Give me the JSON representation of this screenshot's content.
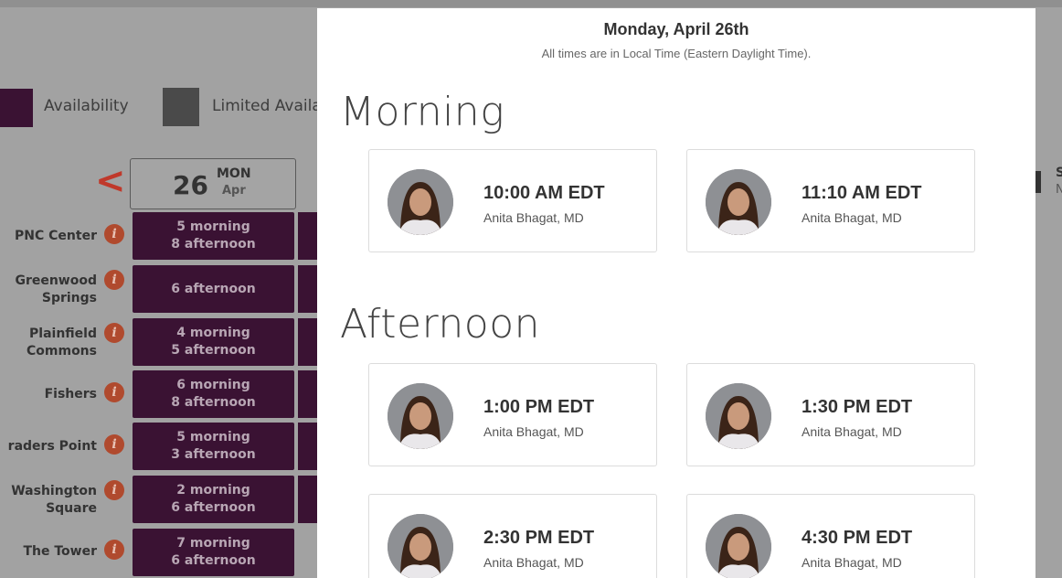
{
  "legend": {
    "availability": "Availability",
    "limited": "Limited Availa"
  },
  "calendar": {
    "prev_arrow": "<",
    "date_day": "26",
    "date_dow": "MON",
    "date_month": "Apr",
    "right_edge_text_1": "S",
    "right_edge_text_2": "N"
  },
  "locations": [
    {
      "name_line1": "PNC Center",
      "name_line2": "",
      "slot_line1": "5 morning",
      "slot_line2": "8 afternoon"
    },
    {
      "name_line1": "Greenwood",
      "name_line2": "Springs",
      "slot_line1": "6 afternoon",
      "slot_line2": ""
    },
    {
      "name_line1": "Plainfield",
      "name_line2": "Commons",
      "slot_line1": "4 morning",
      "slot_line2": "5 afternoon"
    },
    {
      "name_line1": "Fishers",
      "name_line2": "",
      "slot_line1": "6 morning",
      "slot_line2": "8 afternoon"
    },
    {
      "name_line1": "raders Point",
      "name_line2": "",
      "slot_line1": "5 morning",
      "slot_line2": "3 afternoon"
    },
    {
      "name_line1": "Washington",
      "name_line2": "Square",
      "slot_line1": "2 morning",
      "slot_line2": "6 afternoon"
    },
    {
      "name_line1": "The Tower",
      "name_line2": "",
      "slot_line1": "7 morning",
      "slot_line2": "6 afternoon"
    }
  ],
  "info_glyph": "i",
  "modal": {
    "title": "Monday, April 26th",
    "subtitle": "All times are in Local Time (Eastern Daylight Time).",
    "morning_heading": "Morning",
    "afternoon_heading": "Afternoon",
    "morning_slots": [
      {
        "time": "10:00 AM EDT",
        "doctor": "Anita Bhagat, MD"
      },
      {
        "time": "11:10 AM EDT",
        "doctor": "Anita Bhagat, MD"
      }
    ],
    "afternoon_slots": [
      {
        "time": "1:00 PM EDT",
        "doctor": "Anita Bhagat, MD"
      },
      {
        "time": "1:30 PM EDT",
        "doctor": "Anita Bhagat, MD"
      },
      {
        "time": "2:30 PM EDT",
        "doctor": "Anita Bhagat, MD"
      },
      {
        "time": "4:30 PM EDT",
        "doctor": "Anita Bhagat, MD"
      }
    ]
  },
  "colors": {
    "slot_bg": "#3a1233",
    "info_icon": "#b04a2e",
    "prev_arrow": "#c0392b",
    "overlay": "#a2a2a2"
  }
}
